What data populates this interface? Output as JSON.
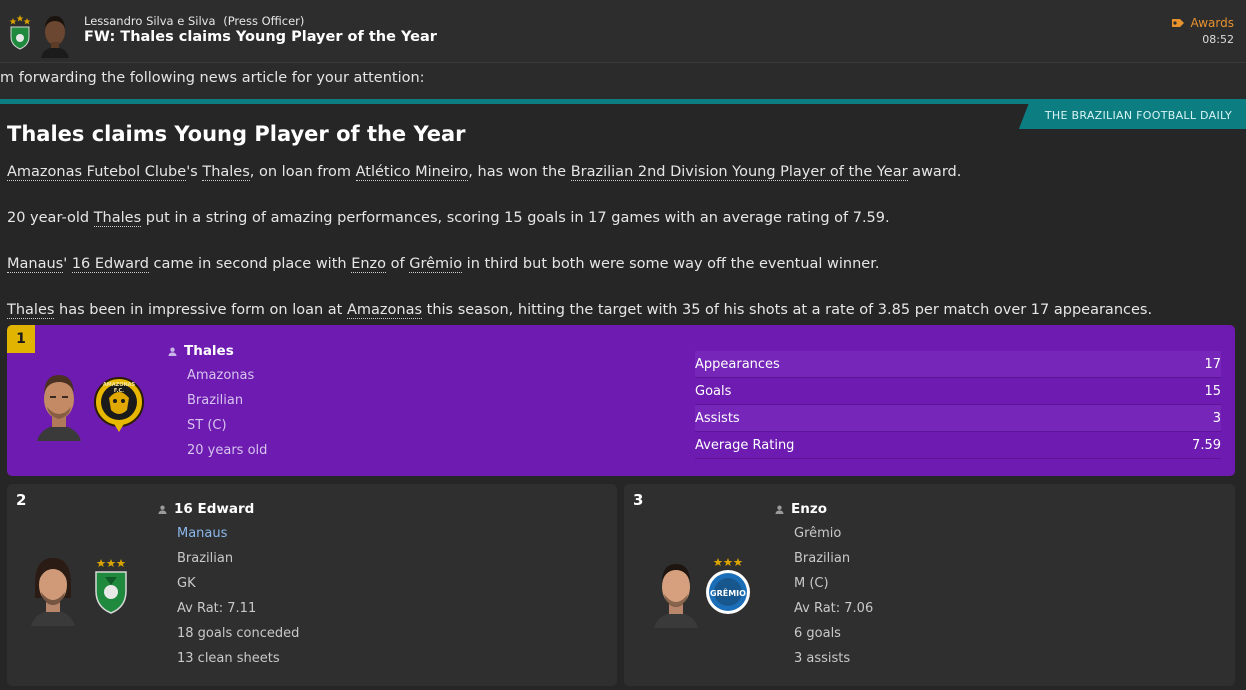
{
  "message": {
    "sender_name": "Lessandro Silva e Silva",
    "sender_role": "(Press Officer)",
    "subject": "FW: Thales claims Young Player of the Year",
    "category": "Awards",
    "time": "08:52",
    "intro": "m forwarding the following news article for your attention:"
  },
  "article": {
    "newspaper": "THE BRAZILIAN FOOTBALL DAILY",
    "headline": "Thales claims Young Player of the Year",
    "p1": {
      "club": "Amazonas Futebol Clube",
      "poss": "'s ",
      "player": "Thales",
      "t1": ", on loan from ",
      "loan_club": "Atlético Mineiro",
      "t2": ", has won the ",
      "award": "Brazilian 2nd Division Young Player of the Year",
      "t3": " award."
    },
    "p2": {
      "t0": "20 year-old ",
      "player": "Thales",
      "t1": " put in a string of amazing performances, scoring 15 goals in 17 games with an average rating of 7.59."
    },
    "p3": {
      "club2": "Manaus",
      "t0": "' ",
      "player2": "16 Edward",
      "t1": " came in second place with ",
      "player3": "Enzo",
      "t2": " of ",
      "club3": "Grêmio",
      "t3": " in third but both were some way off the eventual winner."
    },
    "p4": {
      "player": "Thales",
      "t1": " has been in impressive form on loan at ",
      "club": "Amazonas",
      "t2": " this season, hitting the target with 35 of his shots at a rate of 3.85 per match over 17 appearances."
    }
  },
  "winners": [
    {
      "rank": "1",
      "name": "Thales",
      "club": "Amazonas",
      "nationality": "Brazilian",
      "position": "ST (C)",
      "age": "20 years old",
      "crest_text": "AMAZONAS F.C.",
      "stats": [
        {
          "label": "Appearances",
          "value": "17"
        },
        {
          "label": "Goals",
          "value": "15"
        },
        {
          "label": "Assists",
          "value": "3"
        },
        {
          "label": "Average Rating",
          "value": "7.59"
        }
      ]
    },
    {
      "rank": "2",
      "name": "16 Edward",
      "club": "Manaus",
      "nationality": "Brazilian",
      "position": "GK",
      "rating": "Av Rat: 7.11",
      "line1": "18 goals conceded",
      "line2": "13 clean sheets"
    },
    {
      "rank": "3",
      "name": "Enzo",
      "club": "Grêmio",
      "nationality": "Brazilian",
      "position": "M (C)",
      "rating": "Av Rat: 7.06",
      "line1": "6 goals",
      "line2": "3 assists",
      "crest_text": "GRÊMIO"
    }
  ],
  "colors": {
    "accent_teal": "#0c7d80",
    "winner_purple": "#6d1bb0",
    "rank_gold": "#e0b400",
    "awards_orange": "#e8922e"
  }
}
